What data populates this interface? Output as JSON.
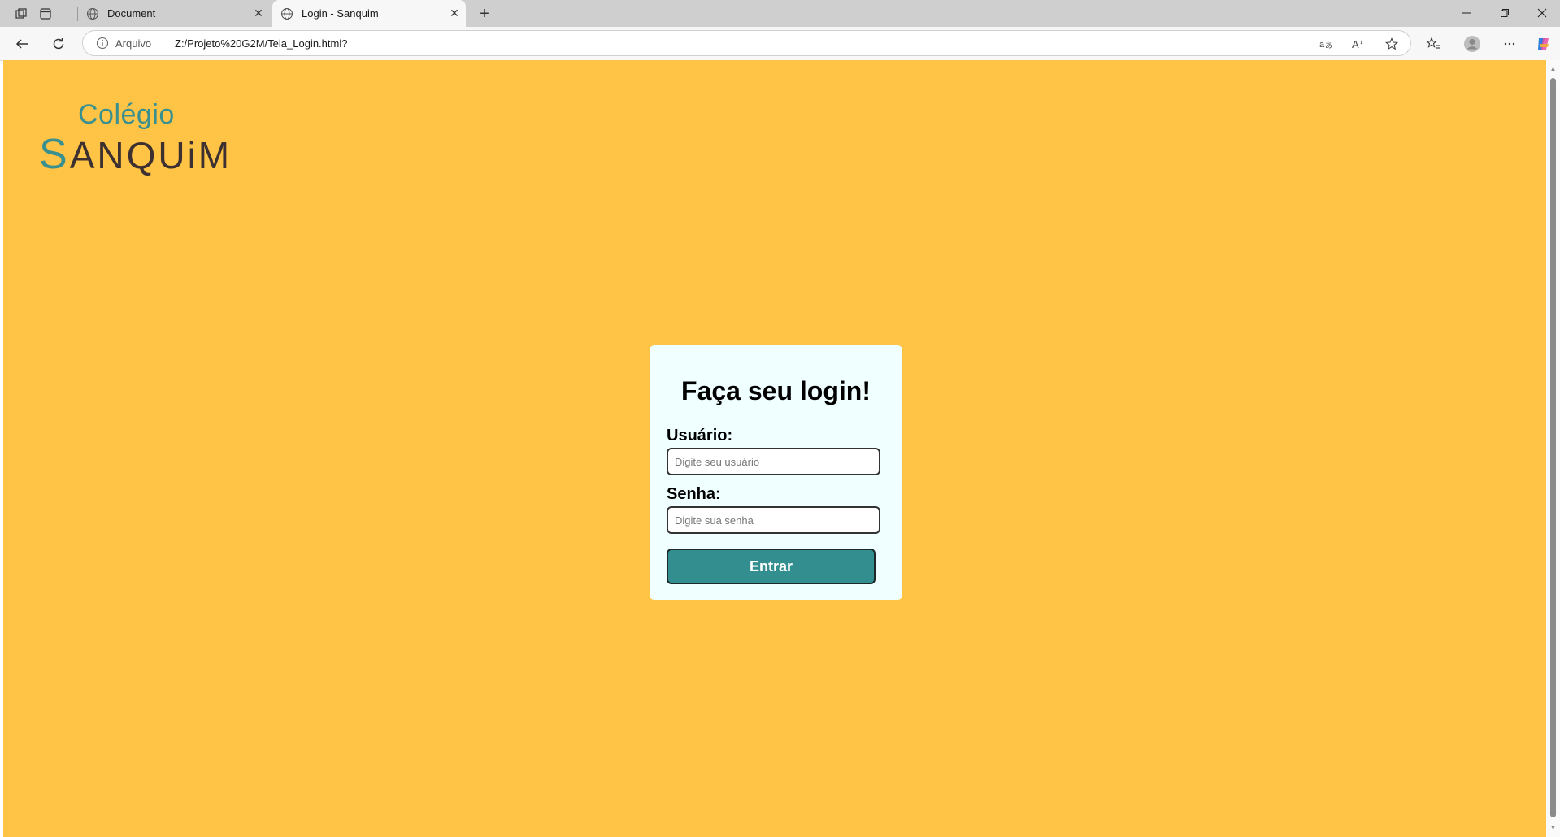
{
  "browser": {
    "tabs": [
      {
        "label": "Document",
        "active": false
      },
      {
        "label": "Login - Sanquim",
        "active": true
      }
    ],
    "address": {
      "label": "Arquivo",
      "url": "Z:/Projeto%20G2M/Tela_Login.html?"
    }
  },
  "logo": {
    "top_text": "Colégio",
    "bottom_first": "S",
    "bottom_rest": "ANQUiM"
  },
  "login": {
    "title": "Faça seu login!",
    "username_label": "Usuário:",
    "username_placeholder": "Digite seu usuário",
    "password_label": "Senha:",
    "password_placeholder": "Digite sua senha",
    "submit_label": "Entrar"
  },
  "colors": {
    "page_background": "#ffc445",
    "card_background": "#f0ffff",
    "button_background": "#338f8f",
    "logo_accent": "#3a8f8f",
    "logo_dark": "#3d3030"
  }
}
